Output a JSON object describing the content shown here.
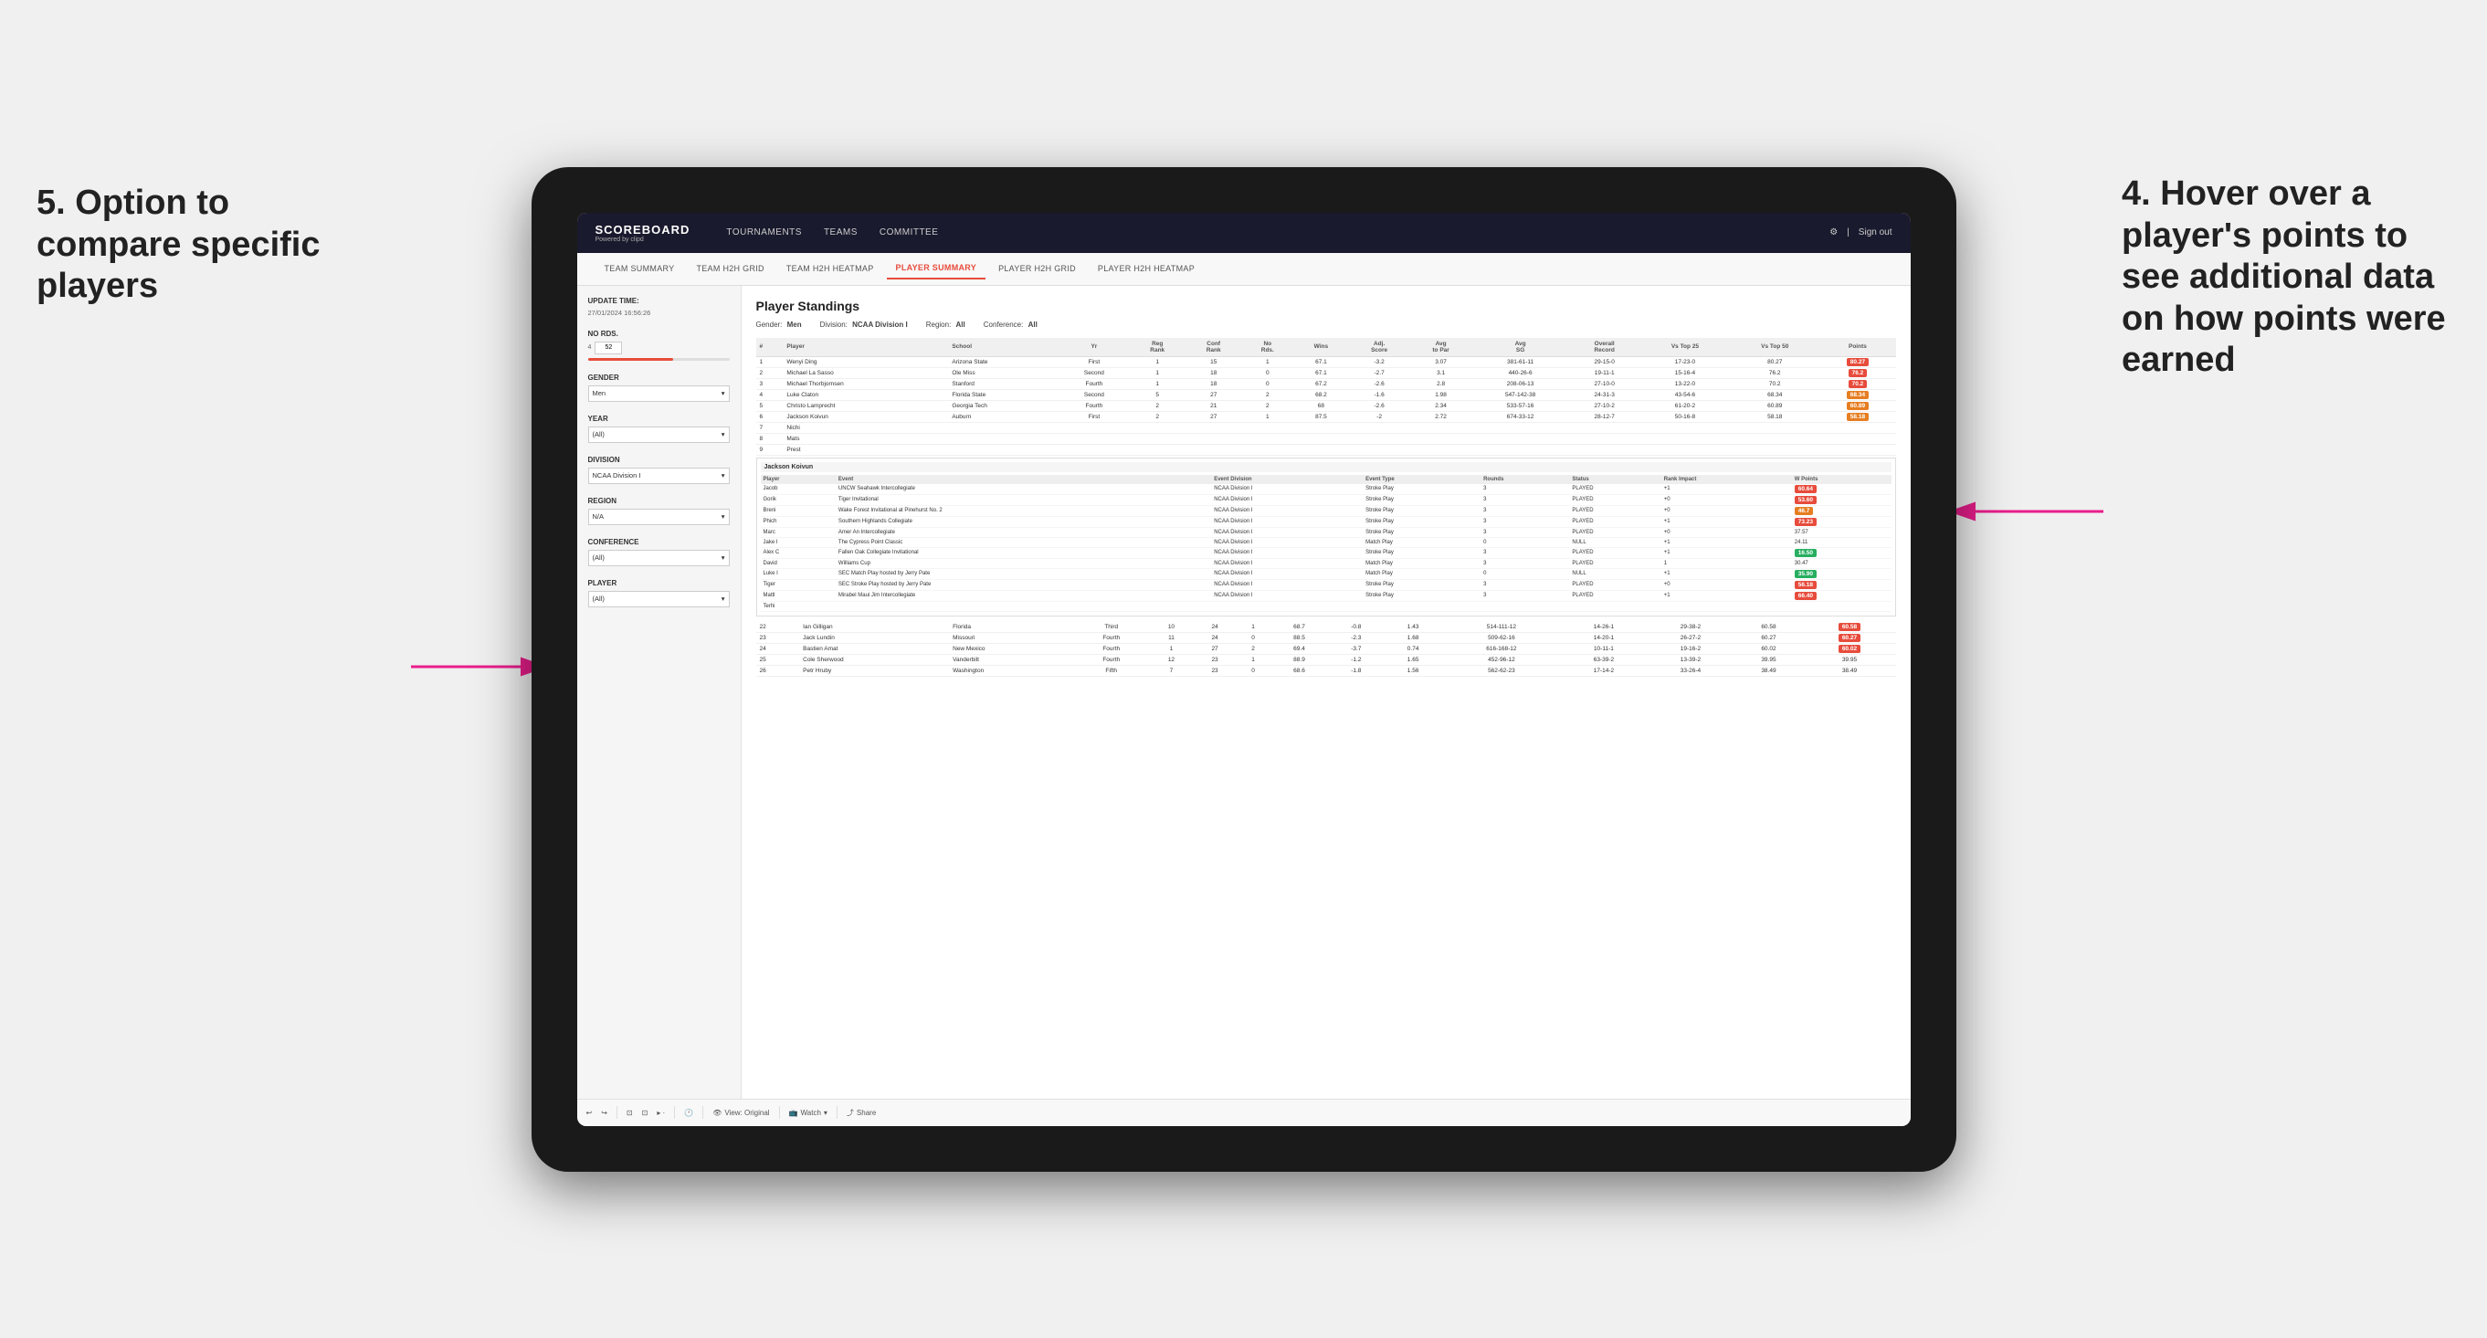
{
  "app": {
    "logo": "SCOREBOARD",
    "logo_sub": "Powered by clipd",
    "nav": {
      "items": [
        "TOURNAMENTS",
        "TEAMS",
        "COMMITTEE"
      ],
      "sign_out": "Sign out"
    },
    "subnav": {
      "items": [
        "TEAM SUMMARY",
        "TEAM H2H GRID",
        "TEAM H2H HEATMAP",
        "PLAYER SUMMARY",
        "PLAYER H2H GRID",
        "PLAYER H2H HEATMAP"
      ],
      "active": "PLAYER SUMMARY"
    }
  },
  "sidebar": {
    "update_time_label": "Update time:",
    "update_time": "27/01/2024 16:56:26",
    "no_rds_label": "No Rds.",
    "no_rds_min": "4",
    "no_rds_max": "52",
    "gender_label": "Gender",
    "gender_value": "Men",
    "year_label": "Year",
    "year_value": "(All)",
    "division_label": "Division",
    "division_value": "NCAA Division I",
    "region_label": "Region",
    "region_value": "N/A",
    "conference_label": "Conference",
    "conference_value": "(All)",
    "player_label": "Player",
    "player_value": "(All)"
  },
  "panel": {
    "title": "Player Standings",
    "filters": {
      "gender_label": "Gender:",
      "gender_value": "Men",
      "division_label": "Division:",
      "division_value": "NCAA Division I",
      "region_label": "Region:",
      "region_value": "All",
      "conference_label": "Conference:",
      "conference_value": "All"
    },
    "table_headers": [
      "#",
      "Player",
      "School",
      "Yr",
      "Reg Rank",
      "Conf Rank",
      "No Rds.",
      "Wins",
      "Adj. Score",
      "Avg to Par",
      "Avg SG",
      "Overall Record",
      "Vs Top 25",
      "Vs Top 50",
      "Points"
    ],
    "top_players": [
      {
        "rank": 1,
        "name": "Wenyi Ding",
        "school": "Arizona State",
        "yr": "First",
        "reg_rank": 1,
        "conf_rank": 15,
        "no_rds": 1,
        "wins": 67.1,
        "adj_score": -3.2,
        "avg_par": 3.07,
        "avg_sg": "381-61-11",
        "overall": "29-15-0",
        "vs25": "17-23-0",
        "vs50": "80.27",
        "points": "80.27",
        "badge": "red"
      },
      {
        "rank": 2,
        "name": "Michael La Sasso",
        "school": "Ole Miss",
        "yr": "Second",
        "reg_rank": 1,
        "conf_rank": 18,
        "no_rds": 0,
        "wins": 67.1,
        "adj_score": -2.7,
        "avg_par": 3.1,
        "avg_sg": "440-26-6",
        "overall": "19-11-1",
        "vs25": "15-16-4",
        "vs50": "76.2",
        "points": "76.2",
        "badge": "red"
      },
      {
        "rank": 3,
        "name": "Michael Thorbjornsen",
        "school": "Stanford",
        "yr": "Fourth",
        "reg_rank": 1,
        "conf_rank": 18,
        "no_rds": 0,
        "wins": 67.2,
        "adj_score": -2.6,
        "avg_par": 2.8,
        "avg_sg": "208-06-13",
        "overall": "27-10-0",
        "vs25": "13-22-0",
        "vs50": "70.2",
        "points": "70.2",
        "badge": "red"
      },
      {
        "rank": 4,
        "name": "Luke Claton",
        "school": "Florida State",
        "yr": "Second",
        "reg_rank": 5,
        "conf_rank": 27,
        "no_rds": 2,
        "wins": 68.2,
        "adj_score": -1.6,
        "avg_par": 1.98,
        "avg_sg": "547-142-38",
        "overall": "24-31-3",
        "vs25": "43-54-6",
        "vs50": "68.34",
        "points": "68.34",
        "badge": "orange"
      },
      {
        "rank": 5,
        "name": "Christo Lamprecht",
        "school": "Georgia Tech",
        "yr": "Fourth",
        "reg_rank": 2,
        "conf_rank": 21,
        "no_rds": 2,
        "wins": 68.0,
        "adj_score": -2.6,
        "avg_par": 2.34,
        "avg_sg": "533-57-16",
        "overall": "27-10-2",
        "vs25": "61-20-2",
        "vs50": "60.89",
        "points": "60.89",
        "badge": "orange"
      },
      {
        "rank": 6,
        "name": "Jackson Koivun",
        "school": "Auburn",
        "yr": "First",
        "reg_rank": 2,
        "conf_rank": 27,
        "no_rds": 1,
        "wins": 87.5,
        "adj_score": -2.0,
        "avg_par": 2.72,
        "avg_sg": "674-33-12",
        "overall": "28-12-7",
        "vs25": "50-16-8",
        "vs50": "58.18",
        "points": "58.18",
        "badge": "orange"
      },
      {
        "rank": 7,
        "name": "Nichi",
        "school": "",
        "yr": "",
        "reg_rank": "",
        "conf_rank": "",
        "no_rds": "",
        "wins": "",
        "adj_score": "",
        "avg_par": "",
        "avg_sg": "",
        "overall": "",
        "vs25": "",
        "vs50": "",
        "points": "",
        "badge": ""
      },
      {
        "rank": 8,
        "name": "Mats",
        "school": "",
        "yr": "",
        "reg_rank": "",
        "conf_rank": "",
        "no_rds": "",
        "wins": "",
        "adj_score": "",
        "avg_par": "",
        "avg_sg": "",
        "overall": "",
        "vs25": "",
        "vs50": "",
        "points": "",
        "badge": ""
      },
      {
        "rank": 9,
        "name": "Prest",
        "school": "",
        "yr": "",
        "reg_rank": "",
        "conf_rank": "",
        "no_rds": "",
        "wins": "",
        "adj_score": "",
        "avg_par": "",
        "avg_sg": "",
        "overall": "",
        "vs25": "",
        "vs50": "",
        "points": "",
        "badge": ""
      }
    ],
    "popup": {
      "player": "Jackson Koivun",
      "headers": [
        "Player",
        "Event",
        "Event Division",
        "Event Type",
        "Rounds",
        "Status",
        "Rank Impact",
        "W Points"
      ],
      "rows": [
        {
          "player": "Jacob",
          "event": "UNCW Seahawk Intercollegiate",
          "div": "NCAA Division I",
          "type": "Stroke Play",
          "rounds": 3,
          "status": "PLAYED",
          "rank": "+1",
          "points": "60.64",
          "badge": "red"
        },
        {
          "player": "Gorik",
          "event": "Tiger Invitational",
          "div": "NCAA Division I",
          "type": "Stroke Play",
          "rounds": 3,
          "status": "PLAYED",
          "rank": "+0",
          "points": "53.60",
          "badge": "red"
        },
        {
          "player": "Breni",
          "event": "Wake Forest Invitational at Pinehurst No. 2",
          "div": "NCAA Division I",
          "type": "Stroke Play",
          "rounds": 3,
          "status": "PLAYED",
          "rank": "+0",
          "points": "46.7",
          "badge": "orange"
        },
        {
          "player": "Phich",
          "event": "Southern Highlands Collegiate",
          "div": "NCAA Division I",
          "type": "Stroke Play",
          "rounds": 3,
          "status": "PLAYED",
          "rank": "+1",
          "points": "73.23",
          "badge": "red"
        },
        {
          "player": "Marc",
          "event": "Amer An Intercollegiate",
          "div": "NCAA Division I",
          "type": "Stroke Play",
          "rounds": 3,
          "status": "PLAYED",
          "rank": "+0",
          "points": "37.57",
          "badge": ""
        },
        {
          "player": "Jake I",
          "event": "The Cypress Point Classic",
          "div": "NCAA Division I",
          "type": "Match Play",
          "rounds": 0,
          "status": "NULL",
          "rank": "+1",
          "points": "24.11",
          "badge": ""
        },
        {
          "player": "Alex C",
          "event": "Fallen Oak Collegiate Invitational",
          "div": "NCAA Division I",
          "type": "Stroke Play",
          "rounds": 3,
          "status": "PLAYED",
          "rank": "+1",
          "points": "16.50",
          "badge": "green"
        },
        {
          "player": "David",
          "event": "Williams Cup",
          "div": "NCAA Division I",
          "type": "Match Play",
          "rounds": 3,
          "status": "PLAYED",
          "rank": "1",
          "points": "30.47",
          "badge": ""
        },
        {
          "player": "Luke I",
          "event": "SEC Match Play hosted by Jerry Pate",
          "div": "NCAA Division I",
          "type": "Match Play",
          "rounds": 0,
          "status": "NULL",
          "rank": "+1",
          "points": "35.90",
          "badge": "green"
        },
        {
          "player": "Tiger",
          "event": "SEC Stroke Play hosted by Jerry Pate",
          "div": "NCAA Division I",
          "type": "Stroke Play",
          "rounds": 3,
          "status": "PLAYED",
          "rank": "+0",
          "points": "56.18",
          "badge": "red"
        },
        {
          "player": "Mattl",
          "event": "Mirabel Maui Jim Intercollegiate",
          "div": "NCAA Division I",
          "type": "Stroke Play",
          "rounds": 3,
          "status": "PLAYED",
          "rank": "+1",
          "points": "66.40",
          "badge": "red"
        },
        {
          "player": "Terhi",
          "event": "",
          "div": "",
          "type": "",
          "rounds": "",
          "status": "",
          "rank": "",
          "points": "",
          "badge": ""
        }
      ]
    },
    "bottom_players": [
      {
        "rank": 22,
        "name": "Ian Gilligan",
        "school": "Florida",
        "yr": "Third",
        "reg_rank": 10,
        "conf_rank": 24,
        "no_rds": 1,
        "wins": 68.7,
        "adj_score": -0.8,
        "avg_par": 1.43,
        "avg_sg": "514-111-12",
        "overall": "14-26-1",
        "vs25": "29-38-2",
        "vs50": "60.58",
        "points": "60.58",
        "badge": "red"
      },
      {
        "rank": 23,
        "name": "Jack Lundin",
        "school": "Missouri",
        "yr": "Fourth",
        "reg_rank": 11,
        "conf_rank": 24,
        "no_rds": 0,
        "wins": 88.5,
        "adj_score": -2.3,
        "avg_par": 1.68,
        "avg_sg": "509-62-16",
        "overall": "14-20-1",
        "vs25": "26-27-2",
        "vs50": "60.27",
        "points": "60.27",
        "badge": "red"
      },
      {
        "rank": 24,
        "name": "Bastien Amat",
        "school": "New Mexico",
        "yr": "Fourth",
        "reg_rank": 1,
        "conf_rank": 27,
        "no_rds": 2,
        "wins": 69.4,
        "adj_score": -3.7,
        "avg_par": 0.74,
        "avg_sg": "616-168-12",
        "overall": "10-11-1",
        "vs25": "19-16-2",
        "vs50": "60.02",
        "points": "60.02",
        "badge": "red"
      },
      {
        "rank": 25,
        "name": "Cole Sherwood",
        "school": "Vanderbilt",
        "yr": "Fourth",
        "reg_rank": 12,
        "conf_rank": 23,
        "no_rds": 1,
        "wins": 88.9,
        "adj_score": -1.2,
        "avg_par": 1.65,
        "avg_sg": "452-96-12",
        "overall": "63-39-2",
        "vs25": "13-39-2",
        "vs50": "39.95",
        "points": "39.95",
        "badge": ""
      },
      {
        "rank": 26,
        "name": "Petr Hruby",
        "school": "Washington",
        "yr": "Fifth",
        "reg_rank": 7,
        "conf_rank": 23,
        "no_rds": 0,
        "wins": 68.6,
        "adj_score": -1.8,
        "avg_par": 1.56,
        "avg_sg": "562-62-23",
        "overall": "17-14-2",
        "vs25": "33-26-4",
        "vs50": "38.49",
        "points": "38.49",
        "badge": ""
      }
    ]
  },
  "toolbar": {
    "undo": "↩",
    "redo": "↪",
    "copy": "⊡",
    "settings": "⚙",
    "view_label": "View: Original",
    "watch_label": "Watch",
    "share_label": "Share"
  },
  "annotations": {
    "left": "5. Option to compare specific players",
    "right": "4. Hover over a player's points to see additional data on how points were earned",
    "arrow_left": "→",
    "arrow_right": "→"
  }
}
